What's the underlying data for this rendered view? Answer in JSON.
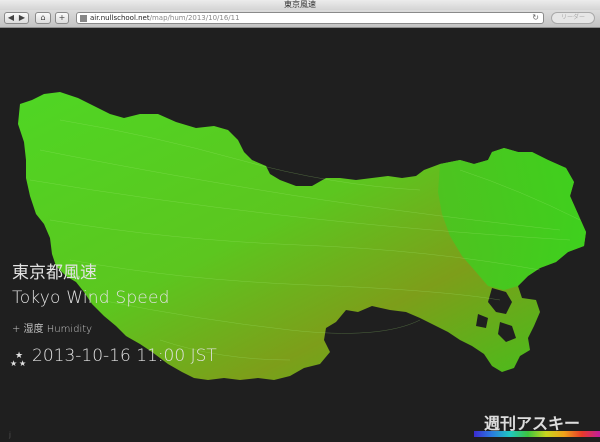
{
  "window": {
    "title": "東京風速"
  },
  "toolbar": {
    "back_glyph": "◀",
    "forward_glyph": "▶",
    "home_glyph": "⌂",
    "add_glyph": "+",
    "url_host": "air.nullschool.net",
    "url_path": "/map/hum/2013/10/16/11",
    "refresh_glyph": "↻",
    "reader_label": "リーダー"
  },
  "overlay": {
    "title_ja": "東京都風速",
    "title_en": "Tokyo Wind Speed",
    "overlay_label": "+ 湿度 Humidity",
    "datetime": "2013-10-16 11:00 JST"
  },
  "corner_mark": "j",
  "watermark": "週刊アスキー",
  "colors": {
    "land_light": "#4cd422",
    "land_mid": "#3fc31e",
    "land_olive": "#6e9a18",
    "background": "#1f1f1f"
  },
  "icons": {
    "stars": "stars-icon",
    "favicon": "favicon-icon"
  }
}
